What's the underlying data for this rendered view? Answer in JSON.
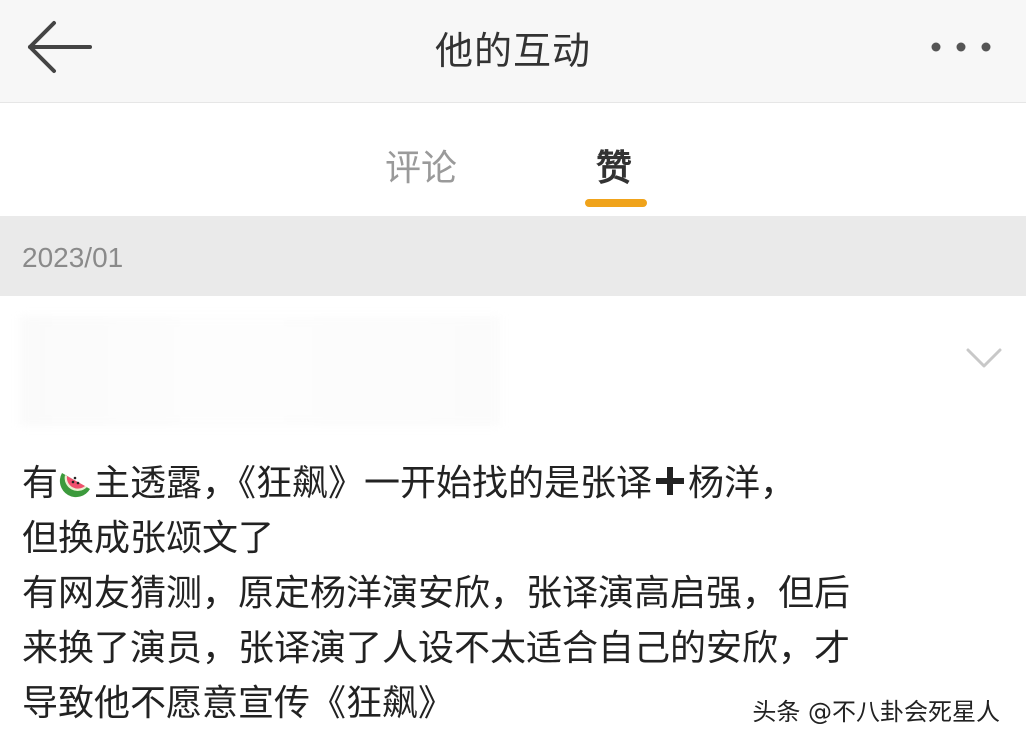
{
  "header": {
    "title": "他的互动",
    "back_icon": "arrow-left-icon",
    "more_icon": "ellipsis-icon"
  },
  "tabs": [
    {
      "label": "评论",
      "active": false
    },
    {
      "label": "赞",
      "active": true
    }
  ],
  "colors": {
    "accent": "#f0a31b",
    "inactive_tab": "#9a9a9a",
    "date_bar": "#eaeaea"
  },
  "feed": {
    "date": "2023/01",
    "post": {
      "line1_a": "有",
      "line1_b": "主透露，《狂飙》一开始找的是张译",
      "line1_c": "杨洋，",
      "line2": "但换成张颂文了",
      "line3": "有网友猜测，原定杨洋演安欣，张译演高启强，但后",
      "line4": "来换了演员，张译演了人设不太适合自己的安欣，才",
      "line5": "导致他不愿意宣传《狂飙》",
      "emoji_1": "watermelon-icon",
      "emoji_2": "plus-icon"
    }
  },
  "watermark": "头条 @不八卦会死星人"
}
